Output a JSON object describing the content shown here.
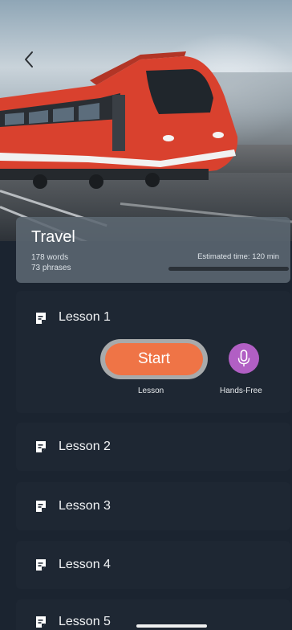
{
  "header": {
    "back_icon": "chevron-left-icon"
  },
  "course": {
    "title": "Travel",
    "words": "178 words",
    "phrases": "73 phrases",
    "estimated_time": "Estimated time: 120 min",
    "progress_fraction": 0
  },
  "actions": {
    "start_label": "Start",
    "lesson_mode_label": "Lesson",
    "hands_free_label": "Hands-Free",
    "hands_free_icon": "microphone-icon"
  },
  "lessons": [
    {
      "label": "Lesson 1"
    },
    {
      "label": "Lesson 2"
    },
    {
      "label": "Lesson 3"
    },
    {
      "label": "Lesson 4"
    },
    {
      "label": "Lesson 5"
    }
  ],
  "colors": {
    "start_button": "#ef7446",
    "hands_free_button": "#b15fc4",
    "card_background": "#1e2733"
  }
}
